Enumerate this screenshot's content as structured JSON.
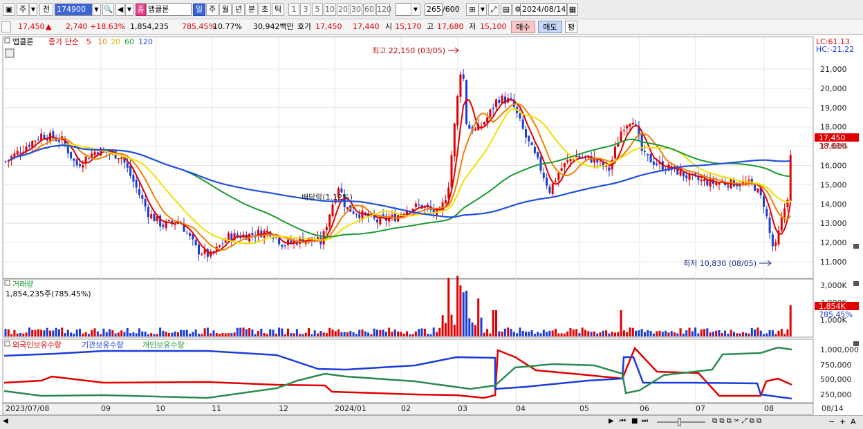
{
  "toolbar": {
    "type_label": "주",
    "prev_label": "전",
    "code": "174900",
    "name_badge": "종",
    "stock_name": "앱클론",
    "periods": [
      "일",
      "주",
      "월",
      "년",
      "분",
      "초",
      "틱"
    ],
    "active_period": "일",
    "intervals": [
      "1",
      "3",
      "5",
      "10",
      "20",
      "30",
      "60",
      "120"
    ],
    "count": "265",
    "count_total": "/600",
    "date": "2024/08/14"
  },
  "quote": {
    "price": "17,450",
    "change": "2,740",
    "change_pct": "+18.63%",
    "volume": "1,854,235",
    "volume_pct": "785.45%",
    "turnover": "10.77%",
    "amount": "30,942백만",
    "bid_label": "호가",
    "bid1": "17,450",
    "bid2": "17,440",
    "open_label": "시",
    "open": "15,170",
    "high_label": "고",
    "high": "17,680",
    "low_label": "저",
    "low": "15,100",
    "buy_label": "매수",
    "sell_label": "매도",
    "eval_label": "평"
  },
  "price_panel": {
    "name": "앱클론",
    "ma_label": "종가 단순",
    "ma_periods": [
      "5",
      "10",
      "20",
      "60",
      "120"
    ],
    "lc": "LC:61.13",
    "hc": "HC:-21.22",
    "y_ticks": [
      "21,000",
      "20,000",
      "19,000",
      "18,000",
      "17,000",
      "16,000",
      "15,000",
      "14,000",
      "13,000",
      "12,000",
      "11,000"
    ],
    "current_price": "17,450",
    "current_pct": "18.63%",
    "high_marker": "최고 22,150 (03/05)",
    "low_marker": "최저 10,830 (08/05)",
    "dividend_label": "배당락(1.12%)"
  },
  "volume_panel": {
    "title": "거래량",
    "value": "1,854,235주(785.45%)",
    "y_ticks": [
      "3,000K",
      "2,000K",
      "1,000K"
    ],
    "current": "1,854K",
    "current_pct": "785.45%"
  },
  "holding_panel": {
    "series": [
      "외국인보유수량",
      "기관보유수량",
      "개인보유수량"
    ],
    "y_ticks": [
      "1,000,000",
      "750,000",
      "500,000",
      "250,000"
    ]
  },
  "x_axis": [
    "2023/07/08",
    "09",
    "10",
    "11",
    "12",
    "2024/01",
    "02",
    "03",
    "04",
    "05",
    "06",
    "07",
    "08",
    "08/14"
  ],
  "colors": {
    "up": "#e00000",
    "down": "#1a3cd8",
    "ma5": "#e00000",
    "ma10": "#f08000",
    "ma20": "#f0e000",
    "ma60": "#1a9a30",
    "ma120": "#2050e0"
  }
}
